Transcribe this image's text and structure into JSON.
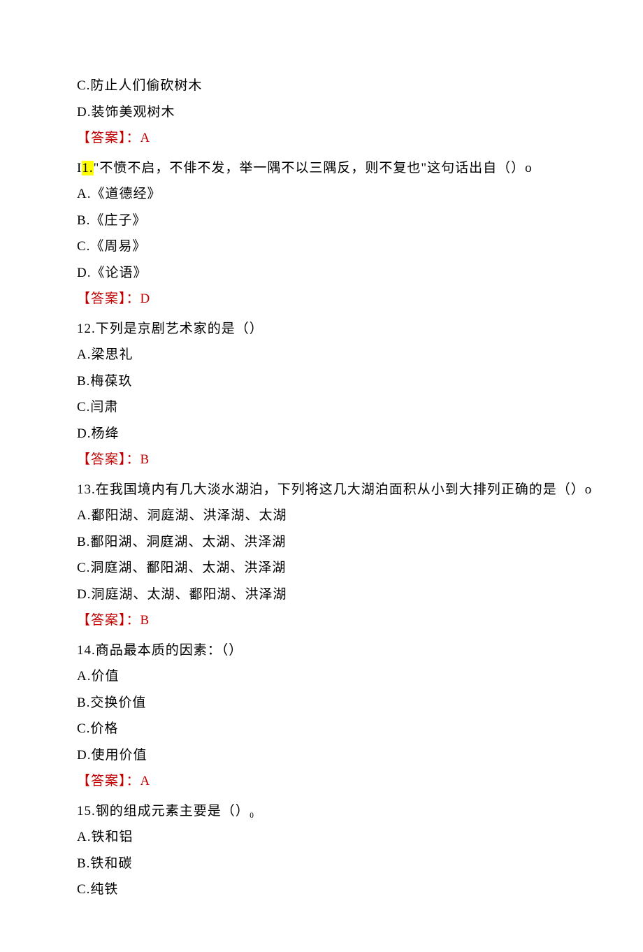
{
  "q10_tail": {
    "optC": "C.防止人们偷砍树木",
    "optD": "D.装饰美观树木",
    "ans_label": "【答案】：",
    "ans_val": "A"
  },
  "q11": {
    "num_prefix": "I",
    "num_hl": "1.",
    "stem": "\"不愤不启，不俳不发，举一隅不以三隅反，则不复也\"这句话出自（）o",
    "optA": "A.《道德经》",
    "optB": "B.《庄子》",
    "optC": "C.《周易》",
    "optD": "D.《论语》",
    "ans_label": "【答案】：",
    "ans_val": "D"
  },
  "q12": {
    "stem": "12.下列是京剧艺术家的是（）",
    "optA": "A.梁思礼",
    "optB": "B.梅葆玖",
    "optC": "C.闫肃",
    "optD": "D.杨绛",
    "ans_label": "【答案】：",
    "ans_val": "B"
  },
  "q13": {
    "stem": "13.在我国境内有几大淡水湖泊，下列将这几大湖泊面积从小到大排列正确的是（）o",
    "optA": "A.鄱阳湖、洞庭湖、洪泽湖、太湖",
    "optB": "B.鄱阳湖、洞庭湖、太湖、洪泽湖",
    "optC": "C.洞庭湖、鄱阳湖、太湖、洪泽湖",
    "optD": "D.洞庭湖、太湖、鄱阳湖、洪泽湖",
    "ans_label": "【答案】：",
    "ans_val": "B"
  },
  "q14": {
    "stem": "14.商品最本质的因素：（）",
    "optA": "A.价值",
    "optB": "B.交换价值",
    "optC": "C.价格",
    "optD": "D.使用价值",
    "ans_label": "【答案】：",
    "ans_val": "A"
  },
  "q15": {
    "stem": "15.钢的组成元素主要是（）₀",
    "optA": "A.铁和铝",
    "optB": "B.铁和碳",
    "optC": "C.纯铁"
  }
}
